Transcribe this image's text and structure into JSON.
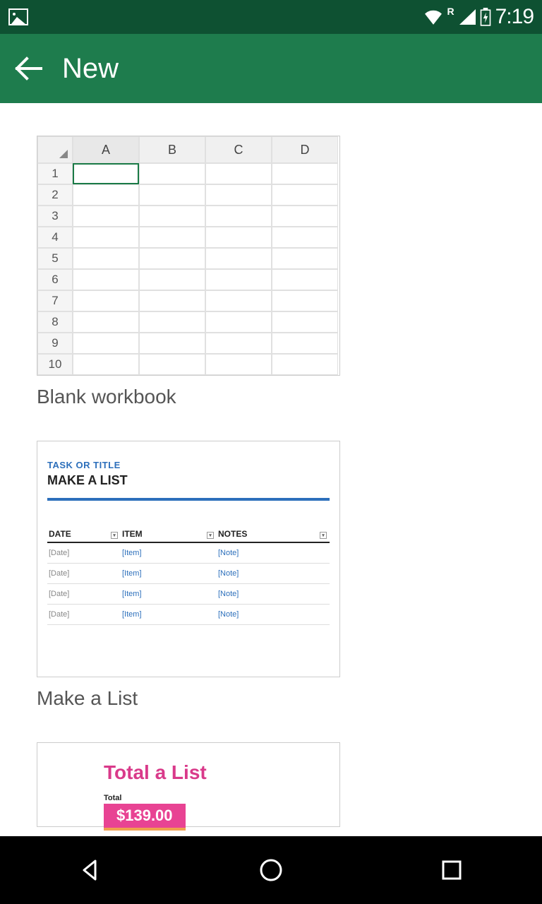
{
  "status": {
    "time": "7:19",
    "roaming": "R"
  },
  "appbar": {
    "title": "New"
  },
  "templates": {
    "blank": {
      "label": "Blank workbook",
      "cols": [
        "A",
        "B",
        "C",
        "D"
      ],
      "rows": [
        "1",
        "2",
        "3",
        "4",
        "5",
        "6",
        "7",
        "8",
        "9",
        "10"
      ]
    },
    "makelist": {
      "label": "Make a List",
      "task_or_title": "TASK OR TITLE",
      "title": "MAKE A LIST",
      "headers": {
        "date": "DATE",
        "item": "ITEM",
        "notes": "NOTES"
      },
      "rows": [
        {
          "date": "[Date]",
          "item": "[Item]",
          "note": "[Note]"
        },
        {
          "date": "[Date]",
          "item": "[Item]",
          "note": "[Note]"
        },
        {
          "date": "[Date]",
          "item": "[Item]",
          "note": "[Note]"
        },
        {
          "date": "[Date]",
          "item": "[Item]",
          "note": "[Note]"
        }
      ]
    },
    "totallist": {
      "title": "Total a List",
      "total_label": "Total",
      "total_value": "$139.00"
    }
  }
}
